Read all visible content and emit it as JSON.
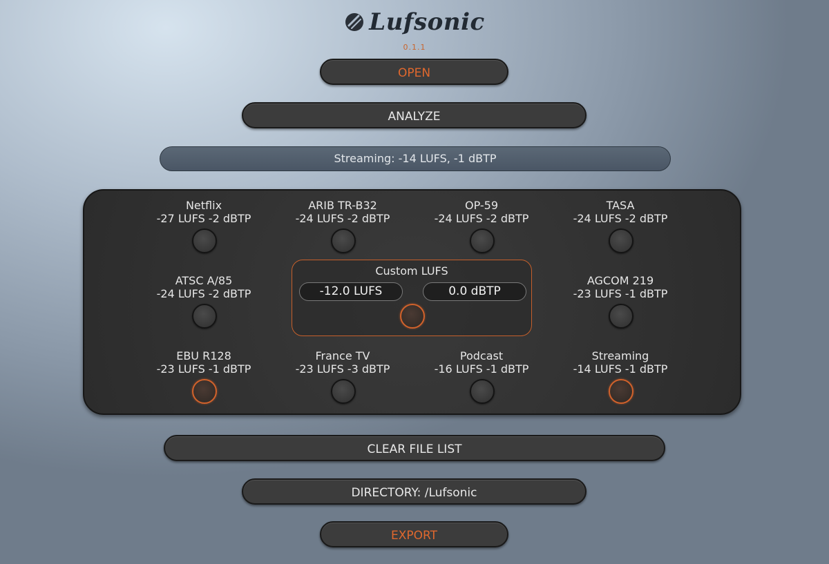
{
  "app": {
    "name": "Lufsonic",
    "version": "0.1.1",
    "logo_icon": "lufsonic-logo-icon"
  },
  "buttons": {
    "open": "OPEN",
    "analyze": "ANALYZE",
    "clear": "CLEAR FILE LIST",
    "directory": "DIRECTORY: /Lufsonic",
    "export": "EXPORT"
  },
  "status": "Streaming: -14 LUFS, -1 dBTP",
  "presets": [
    {
      "name": "Netflix",
      "spec": "-27 LUFS -2 dBTP",
      "selected": false
    },
    {
      "name": "ARIB TR-B32",
      "spec": "-24 LUFS -2 dBTP",
      "selected": false
    },
    {
      "name": "OP-59",
      "spec": "-24 LUFS -2 dBTP",
      "selected": false
    },
    {
      "name": "TASA",
      "spec": "-24 LUFS -2 dBTP",
      "selected": false
    },
    {
      "name": "ATSC A/85",
      "spec": "-24 LUFS -2 dBTP",
      "selected": false
    },
    {
      "name": "AGCOM 219",
      "spec": "-23 LUFS -1 dBTP",
      "selected": false
    },
    {
      "name": "EBU R128",
      "spec": "-23 LUFS -1 dBTP",
      "selected": true
    },
    {
      "name": "France TV",
      "spec": "-23 LUFS -3 dBTP",
      "selected": false
    },
    {
      "name": "Podcast",
      "spec": "-16 LUFS -1 dBTP",
      "selected": false
    },
    {
      "name": "Streaming",
      "spec": "-14 LUFS -1 dBTP",
      "selected": true
    }
  ],
  "custom": {
    "title": "Custom LUFS",
    "lufs_value": "-12.0 LUFS",
    "dbtp_value": "0.0 dBTP",
    "selected": true
  },
  "colors": {
    "accent": "#e0682e",
    "panel": "#2f2f2f"
  }
}
